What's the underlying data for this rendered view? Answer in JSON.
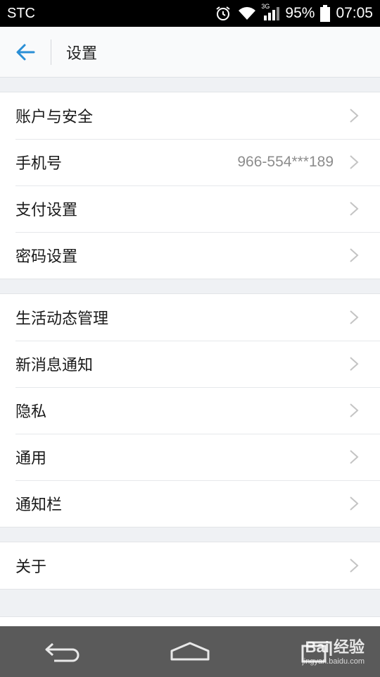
{
  "status_bar": {
    "carrier": "STC",
    "network_type": "3G",
    "battery_percent": "95%",
    "time": "07:05",
    "icons": [
      "alarm-icon",
      "wifi-icon",
      "signal-icon",
      "battery-icon"
    ]
  },
  "header": {
    "title": "设置",
    "back_icon": "back-arrow-icon",
    "accent_color": "#2a8fd6"
  },
  "groups": [
    {
      "items": [
        {
          "label": "账户与安全",
          "value": ""
        },
        {
          "label": "手机号",
          "value": "966-554***189"
        },
        {
          "label": "支付设置",
          "value": ""
        },
        {
          "label": "密码设置",
          "value": ""
        }
      ]
    },
    {
      "items": [
        {
          "label": "生活动态管理",
          "value": ""
        },
        {
          "label": "新消息通知",
          "value": ""
        },
        {
          "label": "隐私",
          "value": ""
        },
        {
          "label": "通用",
          "value": ""
        },
        {
          "label": "通知栏",
          "value": ""
        }
      ]
    },
    {
      "items": [
        {
          "label": "关于",
          "value": ""
        }
      ]
    }
  ],
  "nav_bar": {
    "icons": [
      "back-nav-icon",
      "home-nav-icon",
      "recents-nav-icon"
    ]
  },
  "watermark": {
    "brand": "Bai 经验",
    "url": "jingyan.baidu.com"
  }
}
